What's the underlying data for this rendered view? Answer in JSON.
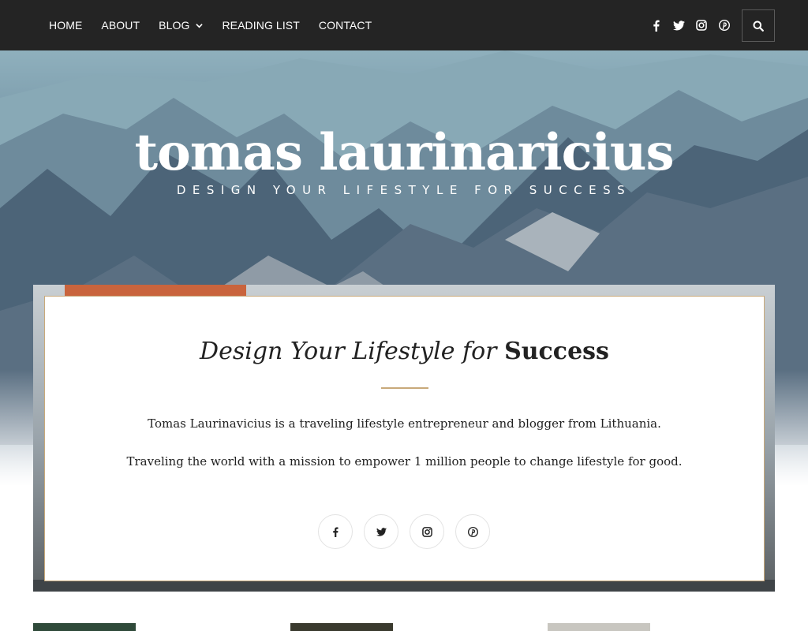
{
  "nav": {
    "links": [
      "HOME",
      "ABOUT",
      "BLOG",
      "READING LIST",
      "CONTACT"
    ],
    "blog_has_dropdown": true,
    "social_icons": [
      "facebook-icon",
      "twitter-icon",
      "instagram-icon",
      "pinterest-icon"
    ],
    "search_icon": "search-icon"
  },
  "hero": {
    "site_title": "tomas laurinaricius",
    "tagline": "DESIGN YOUR LIFESTYLE FOR SUCCESS"
  },
  "card": {
    "title_italic": "Design Your Lifestyle for",
    "title_bold": "Success",
    "paragraph_1": "Tomas Laurinavicius is a traveling lifestyle entrepreneur and blogger from Lithuania.",
    "paragraph_2": "Traveling the world with a mission to empower 1 million people to change lifestyle for good.",
    "social_icons": [
      "facebook-icon",
      "twitter-icon",
      "instagram-icon",
      "pinterest-icon"
    ]
  },
  "colors": {
    "nav_bg": "#242424",
    "accent_gold": "#c8a97a",
    "text_dark": "#222222"
  }
}
